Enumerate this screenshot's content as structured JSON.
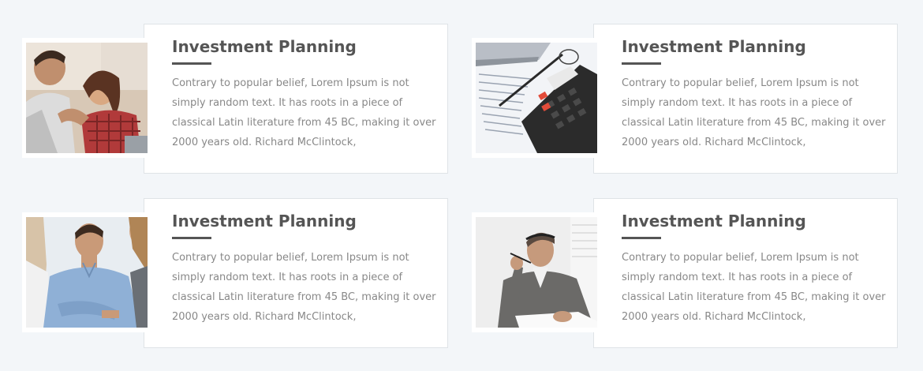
{
  "services": [
    {
      "title": "Investment Planning",
      "description": "Contrary to popular belief, Lorem Ipsum is not simply random text. It has roots in a piece of classical Latin literature from 45 BC, making it over 2000 years old. Richard McClintock,",
      "image": "couple-on-couch-photo"
    },
    {
      "title": "Investment Planning",
      "description": "Contrary to popular belief, Lorem Ipsum is not simply random text. It has roots in a piece of classical Latin literature from 45 BC, making it over 2000 years old. Richard McClintock,",
      "image": "calculator-and-pen-photo"
    },
    {
      "title": "Investment Planning",
      "description": "Contrary to popular belief, Lorem Ipsum is not simply random text. It has roots in a piece of classical Latin literature from 45 BC, making it over 2000 years old. Richard McClintock,",
      "image": "business-meeting-photo"
    },
    {
      "title": "Investment Planning",
      "description": "Contrary to popular belief, Lorem Ipsum is not simply random text. It has roots in a piece of classical Latin literature from 45 BC, making it over 2000 years old. Richard McClintock,",
      "image": "thinking-man-photo"
    }
  ],
  "colors": {
    "page_background": "#f3f6f9",
    "card_background": "#ffffff",
    "card_border": "#dfe3e7",
    "title": "#555555",
    "text": "#888888"
  }
}
